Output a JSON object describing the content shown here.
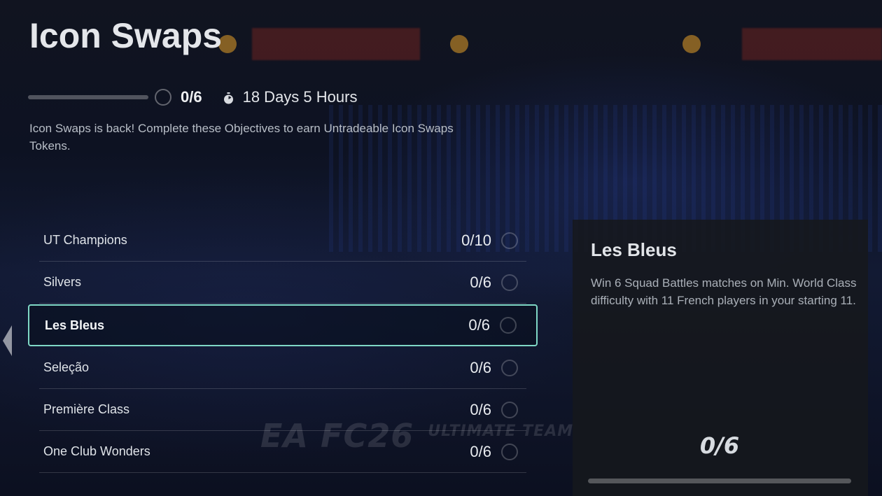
{
  "header": {
    "title": "Icon Swaps",
    "overall_progress_text": "0/6",
    "overall_progress_fraction": 0,
    "timer_icon": "stopwatch-icon",
    "time_remaining": "18 Days 5 Hours",
    "description": "Icon Swaps is back! Complete these Objectives to earn Untradeable Icon Swaps Tokens."
  },
  "objectives": [
    {
      "name": "UT Champions",
      "progress": "0/10",
      "complete": false
    },
    {
      "name": "Silvers",
      "progress": "0/6",
      "complete": false
    },
    {
      "name": "Les Bleus",
      "progress": "0/6",
      "complete": false,
      "selected": true
    },
    {
      "name": "Seleção",
      "progress": "0/6",
      "complete": false
    },
    {
      "name": "Première Class",
      "progress": "0/6",
      "complete": false
    },
    {
      "name": "One Club Wonders",
      "progress": "0/6",
      "complete": false
    }
  ],
  "detail": {
    "title": "Les Bleus",
    "description": "Win 6 Squad Battles matches on Min. World Class difficulty with 11 French players in your starting 11.",
    "progress_text": "0/6",
    "progress_fraction": 0
  },
  "nav": {
    "prev_icon": "chevron-left-icon"
  },
  "colors": {
    "accent": "#7fd8c6",
    "panel": "#16181c"
  }
}
